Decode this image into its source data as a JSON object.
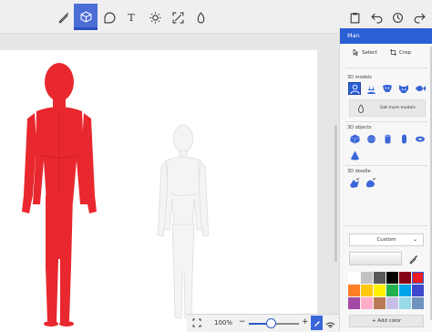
{
  "toolbar": {
    "tools": [
      {
        "name": "art-tools",
        "icon": "brush-icon"
      },
      {
        "name": "3d-shapes",
        "icon": "cube-icon",
        "active": true
      },
      {
        "name": "stickers",
        "icon": "sticker-icon"
      },
      {
        "name": "text",
        "icon": "text-icon",
        "glyph": "T"
      },
      {
        "name": "effects",
        "icon": "sun-icon"
      },
      {
        "name": "canvas",
        "icon": "canvas-icon"
      },
      {
        "name": "3d-library",
        "icon": "library-icon"
      }
    ],
    "right": [
      {
        "name": "paste",
        "icon": "paste-icon"
      },
      {
        "name": "undo",
        "icon": "undo-icon"
      },
      {
        "name": "history",
        "icon": "history-icon"
      },
      {
        "name": "redo",
        "icon": "redo-icon"
      }
    ],
    "accent_color": "#4b6ed6"
  },
  "canvas": {
    "figures": [
      {
        "name": "red-man-model",
        "color": "#e8282e"
      },
      {
        "name": "white-man-model",
        "color": "#f4f4f4"
      }
    ]
  },
  "zoombar": {
    "zoom_percent": "100%",
    "minus": "−",
    "plus": "+",
    "zoom_slider_level": 0.45
  },
  "panel": {
    "title": "Man",
    "select_label": "Select",
    "crop_label": "Crop",
    "models_label": "3D models",
    "models": [
      "man-icon",
      "woman-icon",
      "dog-icon",
      "cat-icon",
      "fish-icon"
    ],
    "get_more_label": "Get more models",
    "objects_label": "3D objects",
    "objects": [
      "cube-icon",
      "sphere-icon",
      "cylinder-icon",
      "capsule-icon",
      "torus-icon",
      "cone-icon"
    ],
    "doodle_label": "3D doodle",
    "doodles": [
      "sharp-doodle-icon",
      "soft-doodle-icon"
    ],
    "material_label": "Custom",
    "add_color_label": "+ Add color",
    "swatches": [
      "#ffffff",
      "#c3c3c3",
      "#585858",
      "#000000",
      "#880015",
      "#ed1c24",
      "#ff7f27",
      "#ffc90e",
      "#fff200",
      "#22b14c",
      "#00a2e8",
      "#3f48cc",
      "#a349a4",
      "#ffaec9",
      "#b97a57",
      "#c8bfe7",
      "#99d9ea",
      "#7092be"
    ],
    "selected_swatch": 5,
    "accent_color": "#2b5fd4"
  }
}
